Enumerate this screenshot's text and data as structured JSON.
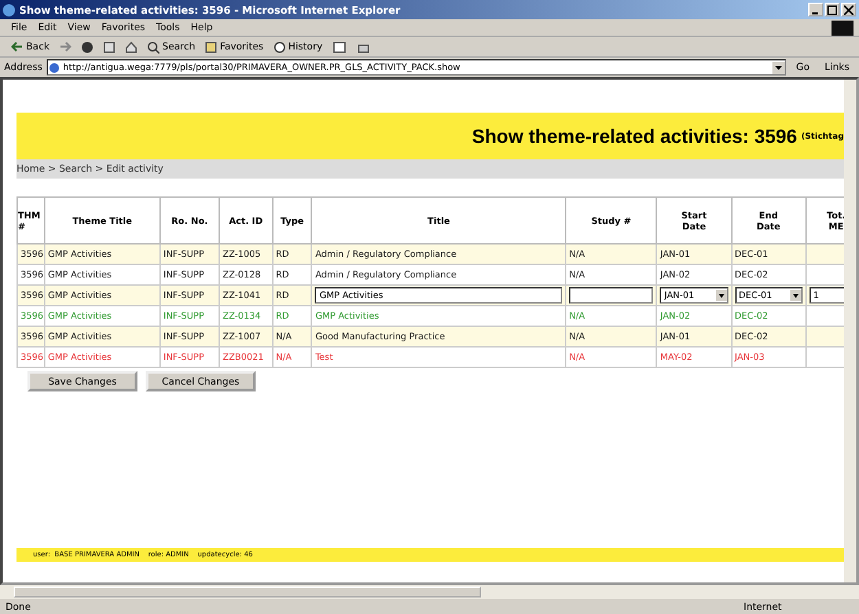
{
  "window": {
    "title": "Show theme-related activities: 3596 - Microsoft Internet Explorer"
  },
  "menu": [
    "File",
    "Edit",
    "View",
    "Favorites",
    "Tools",
    "Help"
  ],
  "toolbar": [
    {
      "kind": "back",
      "label": "Back"
    },
    {
      "kind": "forward"
    },
    {
      "kind": "stop"
    },
    {
      "kind": "refresh"
    },
    {
      "kind": "home"
    },
    {
      "kind": "search",
      "label": "Search"
    },
    {
      "kind": "favorites",
      "label": "Favorites"
    },
    {
      "kind": "history",
      "label": "History"
    },
    {
      "kind": "mail"
    },
    {
      "kind": "print"
    }
  ],
  "address": {
    "label": "Address",
    "url": "http://antigua.wega:7779/pls/portal30/PRIMAVERA_OWNER.PR_GLS_ACTIVITY_PACK.show",
    "go": "Go",
    "links": "Links"
  },
  "banner": {
    "title": "Show theme-related activities: 3596",
    "note": "(Stichtag"
  },
  "breadcrumb": "Home > Search >  Edit activity",
  "table": {
    "columns": [
      "THM\n#",
      "Theme  Title",
      "Ro. No.",
      "Act. ID",
      "Type",
      "Title",
      "Study #",
      "Start\nDate",
      "End\nDate",
      "Tot.\nME"
    ],
    "rows": [
      {
        "kind": "view",
        "color": "#1a1a1a",
        "cells": [
          "3596",
          "GMP Activities",
          "INF-SUPP",
          "ZZ-1005",
          "RD",
          "Admin / Regulatory Compliance",
          "N/A",
          "JAN-01",
          "DEC-01"
        ]
      },
      {
        "kind": "view",
        "color": "#1a1a1a",
        "cells": [
          "3596",
          "GMP Activities",
          "INF-SUPP",
          "ZZ-0128",
          "RD",
          "Admin / Regulatory Compliance",
          "N/A",
          "JAN-02",
          "DEC-02"
        ]
      },
      {
        "kind": "edit",
        "color": "#1a1a1a",
        "cells": [
          "3596",
          "GMP Activities",
          "INF-SUPP",
          "ZZ-1041",
          "RD",
          "GMP Activities",
          "",
          "JAN-01",
          "DEC-01",
          "1"
        ]
      },
      {
        "kind": "view",
        "color": "#2f9a2f",
        "cells": [
          "3596",
          "GMP Activities",
          "INF-SUPP",
          "ZZ-0134",
          "RD",
          "GMP Activities",
          "N/A",
          "JAN-02",
          "DEC-02"
        ]
      },
      {
        "kind": "view",
        "color": "#1a1a1a",
        "cells": [
          "3596",
          "GMP Activities",
          "INF-SUPP",
          "ZZ-1007",
          "N/A",
          "Good Manufacturing Practice",
          "N/A",
          "JAN-01",
          "DEC-02"
        ]
      },
      {
        "kind": "view",
        "color": "#e8363a",
        "cells": [
          "3596",
          "GMP Activities",
          "INF-SUPP",
          "ZZB0021",
          "N/A",
          "Test",
          "N/A",
          "MAY-02",
          "JAN-03"
        ]
      }
    ]
  },
  "buttons": [
    "Save Changes",
    "Cancel Changes"
  ],
  "footer": "user:  BASE PRIMAVERA ADMIN    role: ADMIN    updatecycle: 46",
  "status_bar": {
    "text": "Done",
    "zone": "Internet"
  }
}
